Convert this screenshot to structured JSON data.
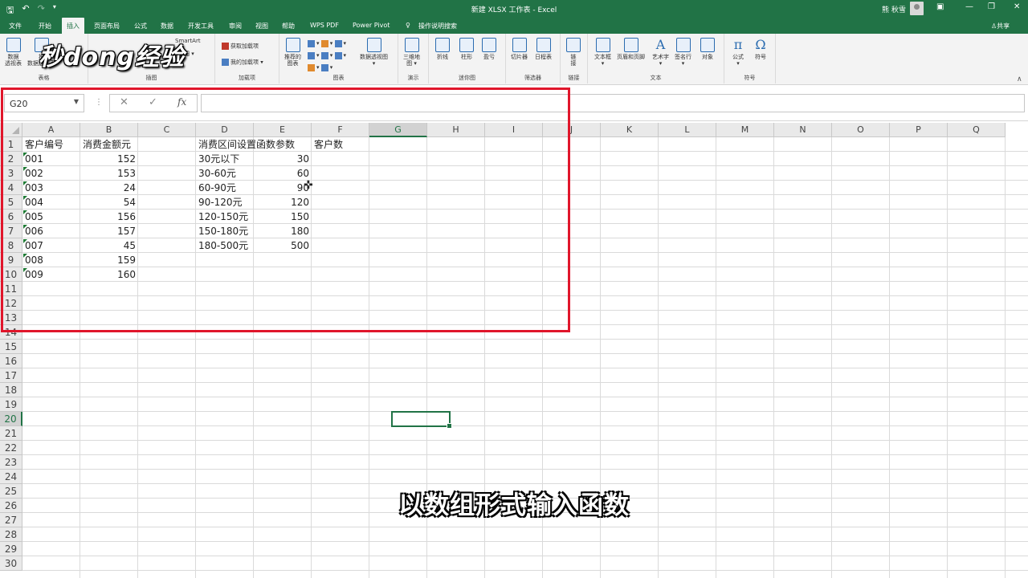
{
  "titlebar": {
    "title": "新建 XLSX 工作表 - Excel",
    "user": "熊 秋雪",
    "save_icon": "save-icon",
    "undo_icon": "undo-icon",
    "redo_icon": "redo-icon"
  },
  "tabs": {
    "items": [
      "文件",
      "开始",
      "插入",
      "页面布局",
      "公式",
      "数据",
      "开发工具",
      "审阅",
      "视图",
      "帮助",
      "WPS PDF",
      "Power Pivot"
    ],
    "search": "操作说明搜索",
    "share": "共享",
    "active": "插入"
  },
  "ribbon": {
    "groups": {
      "tables": "表格",
      "illustrations": "插图",
      "addins": "加载项",
      "charts": "图表",
      "tours": "演示",
      "sparklines": "迷你图",
      "filters": "筛选器",
      "links": "链接",
      "text": "文本",
      "symbols": "符号"
    },
    "buttons": {
      "pivot1": "数据",
      "pivot2": "透视表",
      "rec_pivot1": "推",
      "rec_pivot2": "数据透视表",
      "smartart": "SmartArt",
      "screenshot": "截图",
      "get_addins": "获取加载项",
      "my_addins": "我的加载项",
      "rec_charts1": "推荐的",
      "rec_charts2": "图表",
      "pivot_chart": "数据透视图",
      "map3d1": "三维地",
      "map3d2": "图",
      "line": "折线",
      "column": "柱形",
      "winloss": "盈亏",
      "slicer": "切片器",
      "timeline": "日程表",
      "link1": "链",
      "link2": "接",
      "textbox": "文本框",
      "header_footer": "页眉和页脚",
      "wordart": "艺术字",
      "signature": "签名行",
      "object": "对象",
      "equation": "公式",
      "symbol": "符号"
    }
  },
  "watermark": "秒dong经验",
  "formula_bar": {
    "name_box": "G20",
    "cancel": "✕",
    "enter": "✓",
    "fx": "fx",
    "formula": ""
  },
  "sheet": {
    "columns": [
      "A",
      "B",
      "C",
      "D",
      "E",
      "F",
      "G",
      "H",
      "I",
      "J",
      "K",
      "L",
      "M",
      "N",
      "O",
      "P",
      "Q"
    ],
    "rows": [
      "1",
      "2",
      "3",
      "4",
      "5",
      "6",
      "7",
      "8",
      "9",
      "10",
      "11",
      "12",
      "13",
      "14",
      "15",
      "16",
      "17",
      "18",
      "19",
      "20",
      "21",
      "22",
      "23",
      "24",
      "25",
      "26",
      "27",
      "28",
      "29",
      "30"
    ],
    "selected_column": "G",
    "selected_row": "20",
    "headers": {
      "A1": "客户编号",
      "B1": "消费金额元",
      "D1": "消费区间设置",
      "E1": "函数参数",
      "F1": "客户数"
    },
    "customers": [
      {
        "id": "001",
        "amount": "152"
      },
      {
        "id": "002",
        "amount": "153"
      },
      {
        "id": "003",
        "amount": "24"
      },
      {
        "id": "004",
        "amount": "54"
      },
      {
        "id": "005",
        "amount": "156"
      },
      {
        "id": "006",
        "amount": "157"
      },
      {
        "id": "007",
        "amount": "45"
      },
      {
        "id": "008",
        "amount": "159"
      },
      {
        "id": "009",
        "amount": "160"
      }
    ],
    "ranges": [
      {
        "label": "30元以下",
        "param": "30"
      },
      {
        "label": "30-60元",
        "param": "60"
      },
      {
        "label": "60-90元",
        "param": "90"
      },
      {
        "label": "90-120元",
        "param": "120"
      },
      {
        "label": "120-150元",
        "param": "150"
      },
      {
        "label": "150-180元",
        "param": "180"
      },
      {
        "label": "180-500元",
        "param": "500"
      }
    ]
  },
  "caption": "以数组形式输入函数"
}
